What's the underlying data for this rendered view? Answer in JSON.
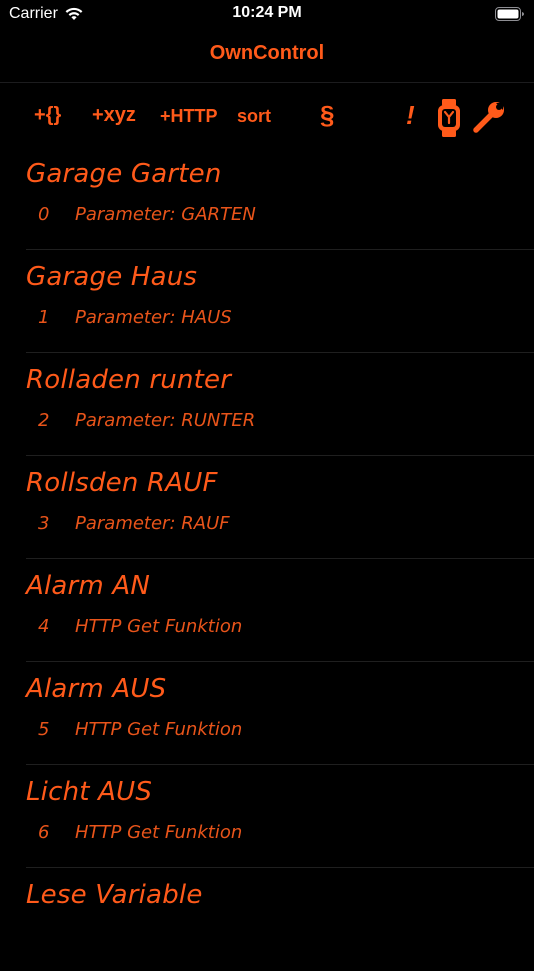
{
  "status_bar": {
    "carrier": "Carrier",
    "time": "10:24 PM"
  },
  "nav": {
    "title": "OwnControl"
  },
  "toolbar": {
    "add_json_label": "+{}",
    "add_xyz_label": "+xyz",
    "add_http_label": "+HTTP",
    "sort_label": "sort",
    "section_label": "§",
    "alert_label": "!",
    "icons": [
      "watch-icon",
      "wrench-icon"
    ]
  },
  "colors": {
    "accent": "#ff5a1a",
    "background": "#000000",
    "divider": "#1f1f1f"
  },
  "items": [
    {
      "title": "Garage Garten",
      "index": "0",
      "subtitle": "Parameter: GARTEN"
    },
    {
      "title": "Garage Haus",
      "index": "1",
      "subtitle": "Parameter: HAUS"
    },
    {
      "title": "Rolladen runter",
      "index": "2",
      "subtitle": "Parameter: RUNTER"
    },
    {
      "title": "Rollsden RAUF",
      "index": "3",
      "subtitle": "Parameter: RAUF"
    },
    {
      "title": "Alarm AN",
      "index": "4",
      "subtitle": "HTTP Get Funktion"
    },
    {
      "title": "Alarm AUS",
      "index": "5",
      "subtitle": "HTTP Get Funktion"
    },
    {
      "title": "Licht AUS",
      "index": "6",
      "subtitle": "HTTP Get Funktion"
    },
    {
      "title": "Lese Variable",
      "index": "",
      "subtitle": ""
    }
  ]
}
